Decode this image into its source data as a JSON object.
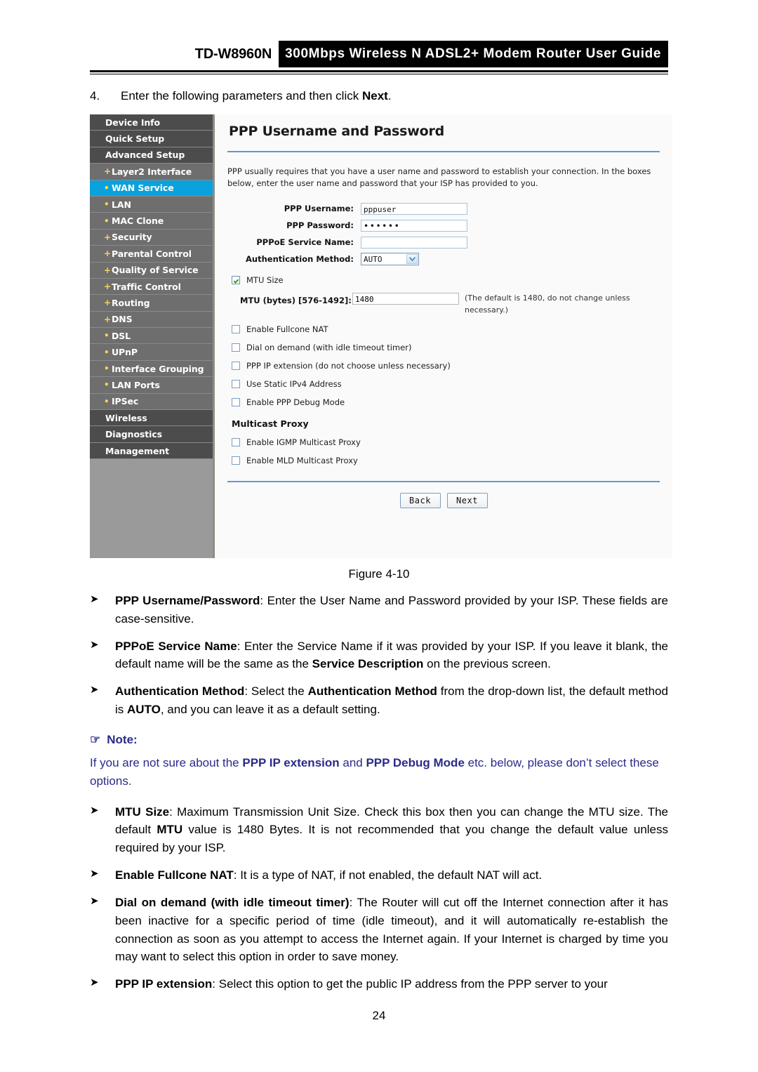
{
  "header": {
    "model": "TD-W8960N",
    "banner": "300Mbps Wireless N ADSL2+ Modem Router User Guide"
  },
  "step": {
    "number": "4.",
    "text_before": "Enter the following parameters and then click ",
    "text_bold": "Next",
    "text_after": "."
  },
  "screenshot": {
    "sidebar": [
      {
        "label": "Device Info",
        "type": "section",
        "mark": "",
        "active": false
      },
      {
        "label": "Quick Setup",
        "type": "section",
        "mark": "",
        "active": false
      },
      {
        "label": "Advanced Setup",
        "type": "section",
        "mark": "",
        "active": false
      },
      {
        "label": "Layer2 Interface",
        "type": "sub",
        "mark": "+",
        "active": false
      },
      {
        "label": "WAN Service",
        "type": "sub",
        "mark": "•",
        "active": true
      },
      {
        "label": "LAN",
        "type": "sub",
        "mark": "•",
        "active": false
      },
      {
        "label": "MAC Clone",
        "type": "sub",
        "mark": "•",
        "active": false
      },
      {
        "label": "Security",
        "type": "sub",
        "mark": "+",
        "active": false
      },
      {
        "label": "Parental Control",
        "type": "sub",
        "mark": "+",
        "active": false
      },
      {
        "label": "Quality of Service",
        "type": "sub",
        "mark": "+",
        "active": false
      },
      {
        "label": "Traffic Control",
        "type": "sub",
        "mark": "+",
        "active": false
      },
      {
        "label": "Routing",
        "type": "sub",
        "mark": "+",
        "active": false
      },
      {
        "label": "DNS",
        "type": "sub",
        "mark": "+",
        "active": false
      },
      {
        "label": "DSL",
        "type": "sub",
        "mark": "•",
        "active": false
      },
      {
        "label": "UPnP",
        "type": "sub",
        "mark": "•",
        "active": false
      },
      {
        "label": "Interface Grouping",
        "type": "sub",
        "mark": "•",
        "active": false
      },
      {
        "label": "LAN Ports",
        "type": "sub",
        "mark": "•",
        "active": false
      },
      {
        "label": "IPSec",
        "type": "sub",
        "mark": "•",
        "active": false
      },
      {
        "label": "Wireless",
        "type": "section",
        "mark": "",
        "active": false
      },
      {
        "label": "Diagnostics",
        "type": "section",
        "mark": "",
        "active": false
      },
      {
        "label": "Management",
        "type": "section",
        "mark": "",
        "active": false
      }
    ],
    "panel_title": "PPP Username and Password",
    "panel_desc": "PPP usually requires that you have a user name and password to establish your connection. In the boxes below, enter the user name and password that your ISP has provided to you.",
    "fields": {
      "username_label": "PPP Username:",
      "username_value": "pppuser",
      "password_label": "PPP Password:",
      "password_value": "••••••",
      "service_label": "PPPoE Service Name:",
      "service_value": "",
      "auth_label": "Authentication Method:",
      "auth_value": "AUTO"
    },
    "mtu": {
      "checkbox_label": "MTU Size",
      "checked": true,
      "field_label": "MTU (bytes) [576-1492]:",
      "value": "1480",
      "hint": "(The default is 1480, do not change unless necessary.)"
    },
    "options": [
      {
        "label": "Enable Fullcone NAT",
        "checked": false
      },
      {
        "label": "Dial on demand (with idle timeout timer)",
        "checked": false
      },
      {
        "label": "PPP IP extension (do not choose unless necessary)",
        "checked": false
      },
      {
        "label": "Use Static IPv4 Address",
        "checked": false
      },
      {
        "label": "Enable PPP Debug Mode",
        "checked": false
      }
    ],
    "multicast": {
      "heading": "Multicast Proxy",
      "options": [
        {
          "label": "Enable IGMP Multicast Proxy",
          "checked": false
        },
        {
          "label": "Enable MLD Multicast Proxy",
          "checked": false
        }
      ]
    },
    "buttons": {
      "back": "Back",
      "next": "Next"
    }
  },
  "figure_caption": "Figure 4-10",
  "bullets": [
    {
      "mark": "➤",
      "parts": [
        {
          "t": "PPP Username/Password",
          "b": true
        },
        {
          "t": ": Enter the User Name and Password provided by your ISP. These fields are case-sensitive.",
          "b": false
        }
      ]
    },
    {
      "mark": "➤",
      "parts": [
        {
          "t": "PPPoE Service Name",
          "b": true
        },
        {
          "t": ": Enter the Service Name if it was provided by your ISP. If you leave it blank, the default name will be the same as the ",
          "b": false
        },
        {
          "t": "Service Description",
          "b": true
        },
        {
          "t": " on the previous screen.",
          "b": false
        }
      ]
    },
    {
      "mark": "➤",
      "parts": [
        {
          "t": "Authentication Method",
          "b": true
        },
        {
          "t": ": Select the ",
          "b": false
        },
        {
          "t": "Authentication Method",
          "b": true
        },
        {
          "t": " from the drop-down list, the default method is ",
          "b": false
        },
        {
          "t": "AUTO",
          "b": true
        },
        {
          "t": ", and you can leave it as a default setting.",
          "b": false
        }
      ]
    }
  ],
  "note": {
    "icon": "☞",
    "heading": "Note:",
    "parts": [
      {
        "t": "If you are not sure about the ",
        "b": false
      },
      {
        "t": "PPP IP extension",
        "b": true
      },
      {
        "t": " and ",
        "b": false
      },
      {
        "t": "PPP Debug Mode",
        "b": true
      },
      {
        "t": " etc. below, please don’t select these options.",
        "b": false
      }
    ]
  },
  "bullets_after": [
    {
      "mark": "➤",
      "parts": [
        {
          "t": "MTU Size",
          "b": true
        },
        {
          "t": ": Maximum Transmission Unit Size. Check this box then you can change the MTU size. The default ",
          "b": false
        },
        {
          "t": "MTU",
          "b": true
        },
        {
          "t": " value is 1480 Bytes. It is not recommended that you change the default value unless required by your ISP.",
          "b": false
        }
      ]
    },
    {
      "mark": "➤",
      "parts": [
        {
          "t": "Enable Fullcone NAT",
          "b": true
        },
        {
          "t": ": It is a type of NAT, if not enabled, the default NAT will act.",
          "b": false
        }
      ]
    },
    {
      "mark": "➤",
      "parts": [
        {
          "t": "Dial on demand (with idle timeout timer)",
          "b": true
        },
        {
          "t": ": The Router will cut off the Internet connection after it has been inactive for a specific period of time (idle timeout), and it will automatically re-establish the connection as soon as you attempt to access the Internet again. If your Internet is charged by time you may want to select this option in order to save money.",
          "b": false
        }
      ]
    },
    {
      "mark": "➤",
      "parts": [
        {
          "t": "PPP IP extension",
          "b": true
        },
        {
          "t": ": Select this option to get the public IP address from the PPP server to your",
          "b": false
        }
      ]
    }
  ],
  "page_number": "24",
  "colors": {
    "accent_blue": "#0aa2dc",
    "rule_blue": "#5b9bd1",
    "note_blue": "#2a2a8c",
    "sidebar_section": "#4c4c4c",
    "sidebar_sub": "#6e6e6e",
    "mark_yellow": "#ffd24a"
  }
}
